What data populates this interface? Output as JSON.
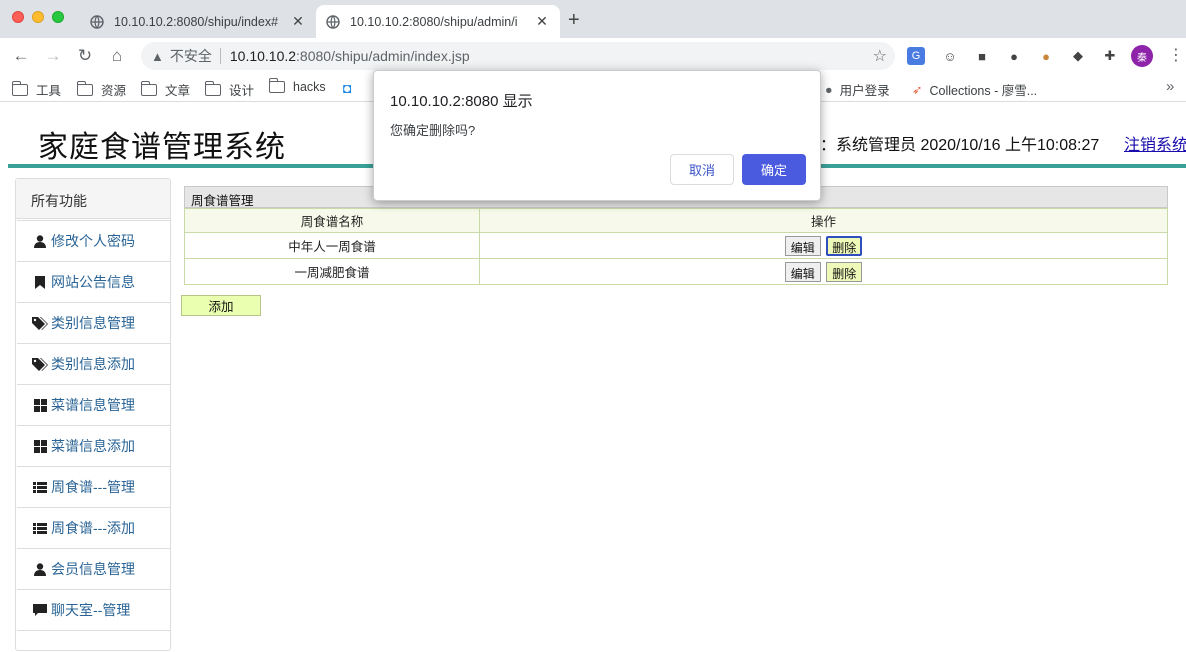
{
  "browser": {
    "tabs": [
      {
        "title": "10.10.10.2:8080/shipu/index#"
      },
      {
        "title": "10.10.10.2:8080/shipu/admin/i"
      }
    ],
    "address": {
      "insecure_label": "不安全",
      "host": "10.10.10.2",
      "path": ":8080/shipu/admin/index.jsp"
    },
    "avatar_letter": "秦",
    "bookmarks": [
      {
        "label": "工具"
      },
      {
        "label": "资源"
      },
      {
        "label": "文章"
      },
      {
        "label": "设计"
      },
      {
        "label": "hacks"
      },
      {
        "label": "用户登录"
      },
      {
        "label": "Collections - 廖雪..."
      }
    ]
  },
  "header": {
    "title": "家庭食谱管理系统",
    "user_info": "：系统管理员  2020/10/16 上午10:08:27",
    "logout": "注销系统"
  },
  "sidebar": {
    "heading": "所有功能",
    "items": [
      {
        "label": "修改个人密码",
        "icon": "user-icon"
      },
      {
        "label": "网站公告信息",
        "icon": "bookmark-icon"
      },
      {
        "label": "类别信息管理",
        "icon": "tags-icon"
      },
      {
        "label": "类别信息添加",
        "icon": "tags-icon"
      },
      {
        "label": "菜谱信息管理",
        "icon": "th-large-icon"
      },
      {
        "label": "菜谱信息添加",
        "icon": "th-large-icon"
      },
      {
        "label": "周食谱---管理",
        "icon": "th-list-icon"
      },
      {
        "label": "周食谱---添加",
        "icon": "th-list-icon"
      },
      {
        "label": "会员信息管理",
        "icon": "user-icon"
      },
      {
        "label": "聊天室--管理",
        "icon": "comment-icon"
      }
    ]
  },
  "panel": {
    "title": "周食谱管理",
    "columns": [
      "周食谱名称",
      "操作"
    ],
    "rows": [
      {
        "name": "中年人一周食谱",
        "edit": "编辑",
        "delete": "删除"
      },
      {
        "name": "一周减肥食谱",
        "edit": "编辑",
        "delete": "删除"
      }
    ],
    "add_label": "添加"
  },
  "dialog": {
    "title": "10.10.10.2:8080 显示",
    "message": "您确定删除吗?",
    "cancel": "取消",
    "ok": "确定"
  }
}
